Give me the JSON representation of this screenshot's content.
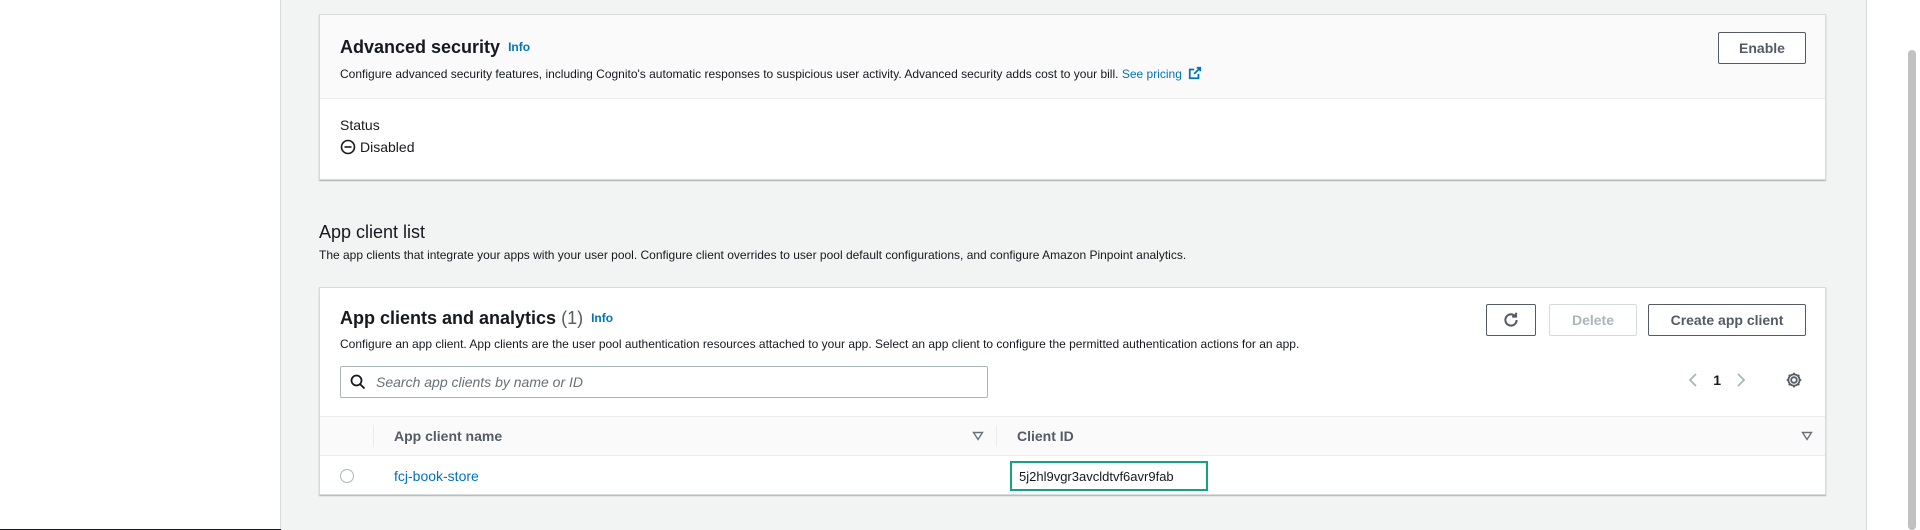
{
  "advanced_security": {
    "title": "Advanced security",
    "info": "Info",
    "description": "Configure advanced security features, including Cognito's automatic responses to suspicious user activity. Advanced security adds cost to your bill.",
    "see_pricing": "See pricing",
    "enable_label": "Enable",
    "status_label": "Status",
    "status_value": "Disabled"
  },
  "app_client_list": {
    "title": "App client list",
    "description": "The app clients that integrate your apps with your user pool. Configure client overrides to user pool default configurations, and configure Amazon Pinpoint analytics."
  },
  "app_clients": {
    "title": "App clients and analytics",
    "count": "(1)",
    "info": "Info",
    "description": "Configure an app client. App clients are the user pool authentication resources attached to your app. Select an app client to configure the permitted authentication actions for an app.",
    "delete_label": "Delete",
    "create_label": "Create app client",
    "search_placeholder": "Search app clients by name or ID",
    "page": "1",
    "columns": [
      "App client name",
      "Client ID"
    ],
    "rows": [
      {
        "name": "fcj-book-store",
        "client_id": "5j2hl9vgr3avcldtvf6avr9fab"
      }
    ]
  },
  "colors": {
    "link": "#0073bb",
    "highlight": "#16a085",
    "border": "#d5dbdb"
  }
}
